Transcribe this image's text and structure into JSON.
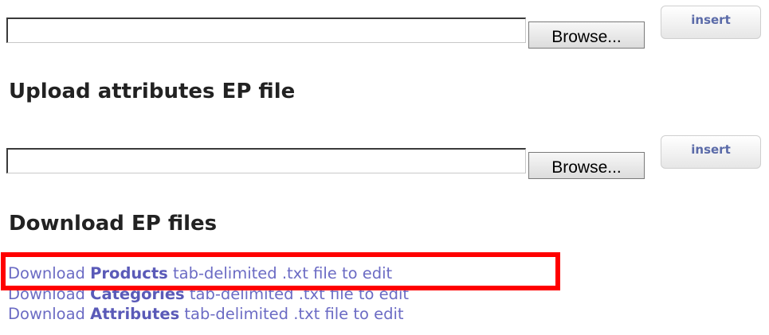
{
  "section_top": {
    "browse_label": "Browse...",
    "insert_label": "insert"
  },
  "upload_attributes": {
    "title": "Upload attributes EP file",
    "browse_label": "Browse...",
    "insert_label": "insert"
  },
  "download": {
    "title": "Download EP files",
    "links": [
      {
        "prefix": "Download",
        "bold": "Products",
        "suffix": "tab-delimited .txt file to edit"
      },
      {
        "prefix": "Download",
        "bold": "Categories",
        "suffix": "tab-delimited .txt file to edit"
      },
      {
        "prefix": "Download",
        "bold": "Attributes",
        "suffix": "tab-delimited .txt file to edit"
      }
    ]
  },
  "colors": {
    "highlight": "#ff0000",
    "link": "#6b6bc4",
    "insert_text": "#5a6aa8"
  }
}
